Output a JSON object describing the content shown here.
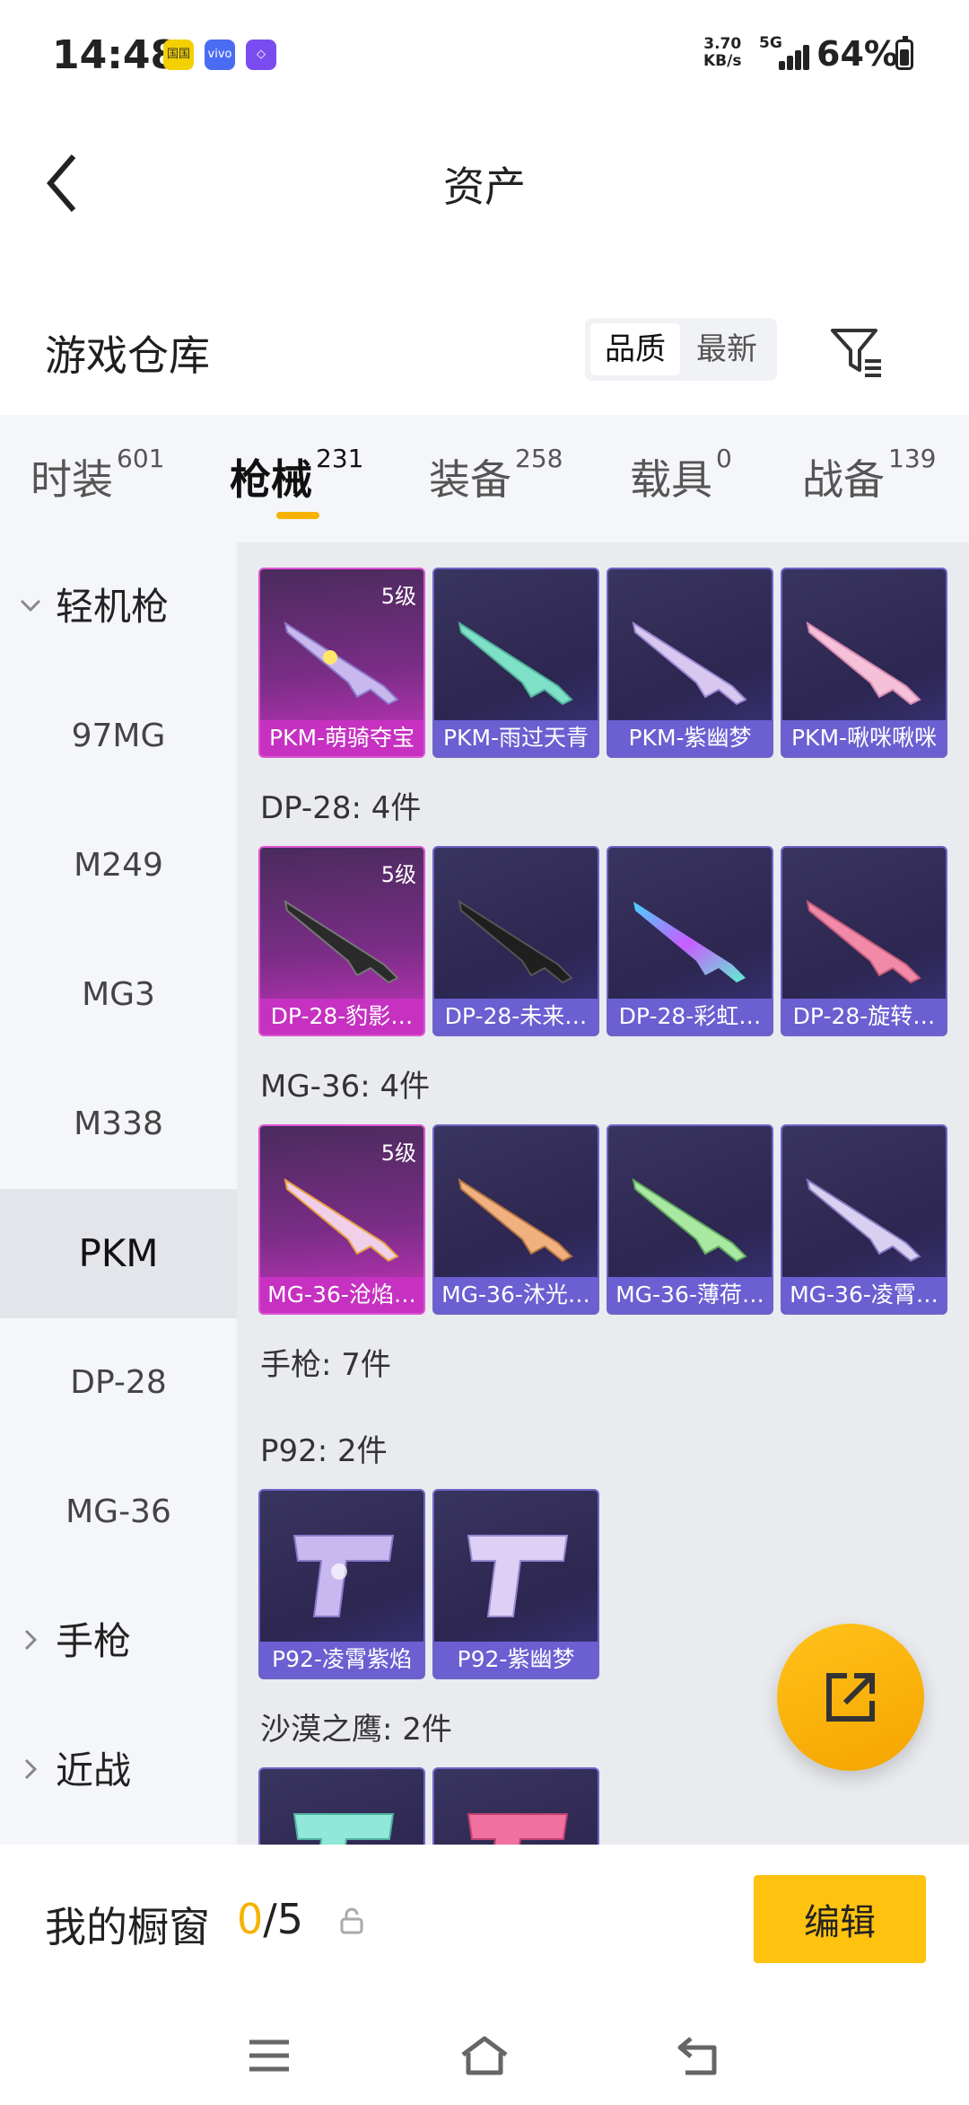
{
  "status": {
    "time": "14:48",
    "net_speed_value": "3.70",
    "net_speed_unit": "KB/s",
    "network": "5G",
    "battery": "64%",
    "icons": [
      "app-icon-yellow",
      "vivo-icon",
      "app-icon-purple"
    ],
    "icon_labels": [
      "国国",
      "vivo",
      "◇"
    ]
  },
  "header": {
    "title": "资产",
    "back_icon": "chevron-left-icon"
  },
  "warehouse": {
    "title": "游戏仓库",
    "sort_quality": "品质",
    "sort_newest": "最新",
    "filter_icon": "filter-icon"
  },
  "tabs": [
    {
      "label": "时装",
      "count": "601"
    },
    {
      "label": "枪械",
      "count": "231"
    },
    {
      "label": "装备",
      "count": "258"
    },
    {
      "label": "载具",
      "count": "0"
    },
    {
      "label": "战备",
      "count": "139"
    }
  ],
  "sidebar": {
    "group_lmg": "轻机枪",
    "items": [
      "97MG",
      "M249",
      "MG3",
      "M338",
      "PKM",
      "DP-28",
      "MG-36"
    ],
    "group_pistol": "手枪",
    "group_melee": "近战"
  },
  "content": {
    "pkm_cards": [
      {
        "name": "PKM-萌骑夺宝",
        "level": "5级"
      },
      {
        "name": "PKM-雨过天青"
      },
      {
        "name": "PKM-紫幽梦"
      },
      {
        "name": "PKM-啾咪啾咪"
      }
    ],
    "dp28_header": "DP-28: 4件",
    "dp28_cards": [
      {
        "name": "DP-28-豹影…",
        "level": "5级"
      },
      {
        "name": "DP-28-未来…"
      },
      {
        "name": "DP-28-彩虹…"
      },
      {
        "name": "DP-28-旋转…"
      }
    ],
    "mg36_header": "MG-36: 4件",
    "mg36_cards": [
      {
        "name": "MG-36-沧焰…",
        "level": "5级"
      },
      {
        "name": "MG-36-沐光…"
      },
      {
        "name": "MG-36-薄荷…"
      },
      {
        "name": "MG-36-凌霄…"
      }
    ],
    "pistol_header": "手枪: 7件",
    "p92_header": "P92: 2件",
    "p92_cards": [
      {
        "name": "P92-凌霄紫焰"
      },
      {
        "name": "P92-紫幽梦"
      }
    ],
    "deagle_header": "沙漠之鹰: 2件"
  },
  "fab": {
    "icon": "share-icon"
  },
  "showcase": {
    "title": "我的橱窗",
    "current": "0",
    "total": "/5",
    "edit": "编辑",
    "lock_icon": "lock-icon"
  },
  "navbar": {
    "icons": [
      "menu-icon",
      "home-icon",
      "back-icon"
    ]
  },
  "colors": {
    "accent": "#ffc20e",
    "gold_card": "#c631c1",
    "purple_card": "#6b5fd1"
  }
}
